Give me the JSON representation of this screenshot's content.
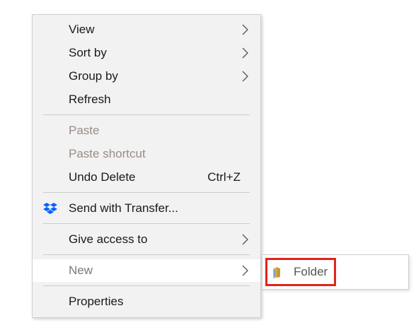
{
  "context_menu": {
    "items": [
      {
        "label": "View",
        "has_submenu": true
      },
      {
        "label": "Sort by",
        "has_submenu": true
      },
      {
        "label": "Group by",
        "has_submenu": true
      },
      {
        "label": "Refresh"
      },
      {
        "label": "Paste",
        "disabled": true
      },
      {
        "label": "Paste shortcut",
        "disabled": true
      },
      {
        "label": "Undo Delete",
        "shortcut": "Ctrl+Z"
      },
      {
        "label": "Send with Transfer...",
        "icon": "dropbox-icon"
      },
      {
        "label": "Give access to",
        "has_submenu": true
      },
      {
        "label": "New",
        "has_submenu": true,
        "highlighted": true
      },
      {
        "label": "Properties"
      }
    ]
  },
  "new_submenu": {
    "items": [
      {
        "label": "Folder",
        "icon": "folder-icon",
        "highlight_color": "#e0241b"
      }
    ]
  },
  "colors": {
    "menu_background": "#f2f2f2",
    "disabled_text": "#9b8b86",
    "selection_outline": "#e0241b"
  }
}
